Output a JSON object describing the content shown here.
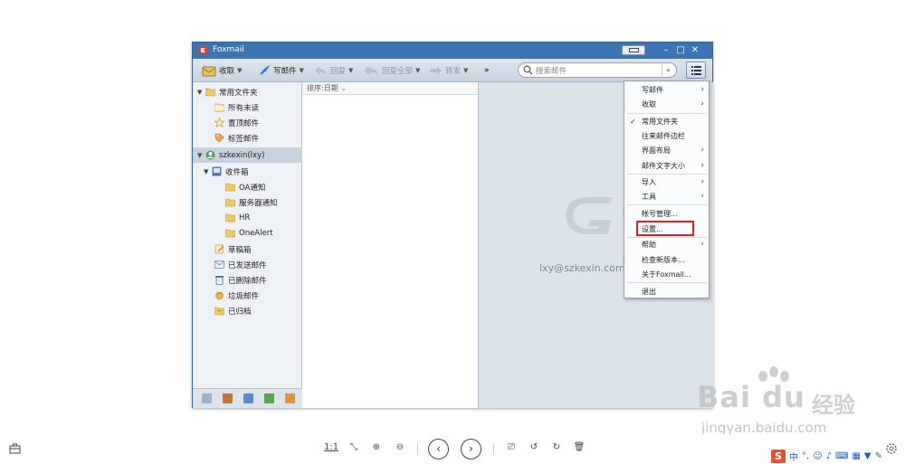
{
  "window": {
    "title": "Foxmail"
  },
  "toolbar": {
    "receive": "收取",
    "compose": "写邮件",
    "reply": "回复",
    "reply_all": "回复全部",
    "forward": "转发",
    "more": "»",
    "search_placeholder": "搜索邮件"
  },
  "folders": {
    "common_group": "常用文件夹",
    "all_unread": "所有未读",
    "pinned": "置顶邮件",
    "tagged": "标签邮件",
    "account": "szkexin(lxy)",
    "inbox": "收件箱",
    "sub_oa": "OA通知",
    "sub_server": "服务器通知",
    "sub_hr": "HR",
    "sub_onealert": "OneAlert",
    "drafts": "草稿箱",
    "sent": "已发送邮件",
    "deleted": "已删除邮件",
    "junk": "垃圾邮件",
    "archived": "已归档"
  },
  "list": {
    "sort_label": "排序:日期"
  },
  "reading": {
    "email": "lxy@szkexin.com"
  },
  "menu": {
    "compose": "写邮件",
    "receive": "收取",
    "common_folders": "常用文件夹",
    "contact_sidebar": "往来邮件边栏",
    "layout": "界面布局",
    "font_size": "邮件文字大小",
    "import": "导入",
    "tools": "工具",
    "accounts": "帐号管理...",
    "settings": "设置...",
    "help": "帮助",
    "check_update": "检查新版本...",
    "about": "关于Foxmail...",
    "exit": "退出"
  },
  "viewer": {
    "actual_size": "1:1"
  },
  "watermark": {
    "brand": "Bai du",
    "brand_cn": "经验",
    "url": "jingyan.baidu.com"
  },
  "ime": {
    "logo": "S",
    "lang": "中"
  },
  "colors": {
    "titlebar": "#3b74b0",
    "highlight_box": "#d42222",
    "ime_logo": "#e8512b"
  }
}
